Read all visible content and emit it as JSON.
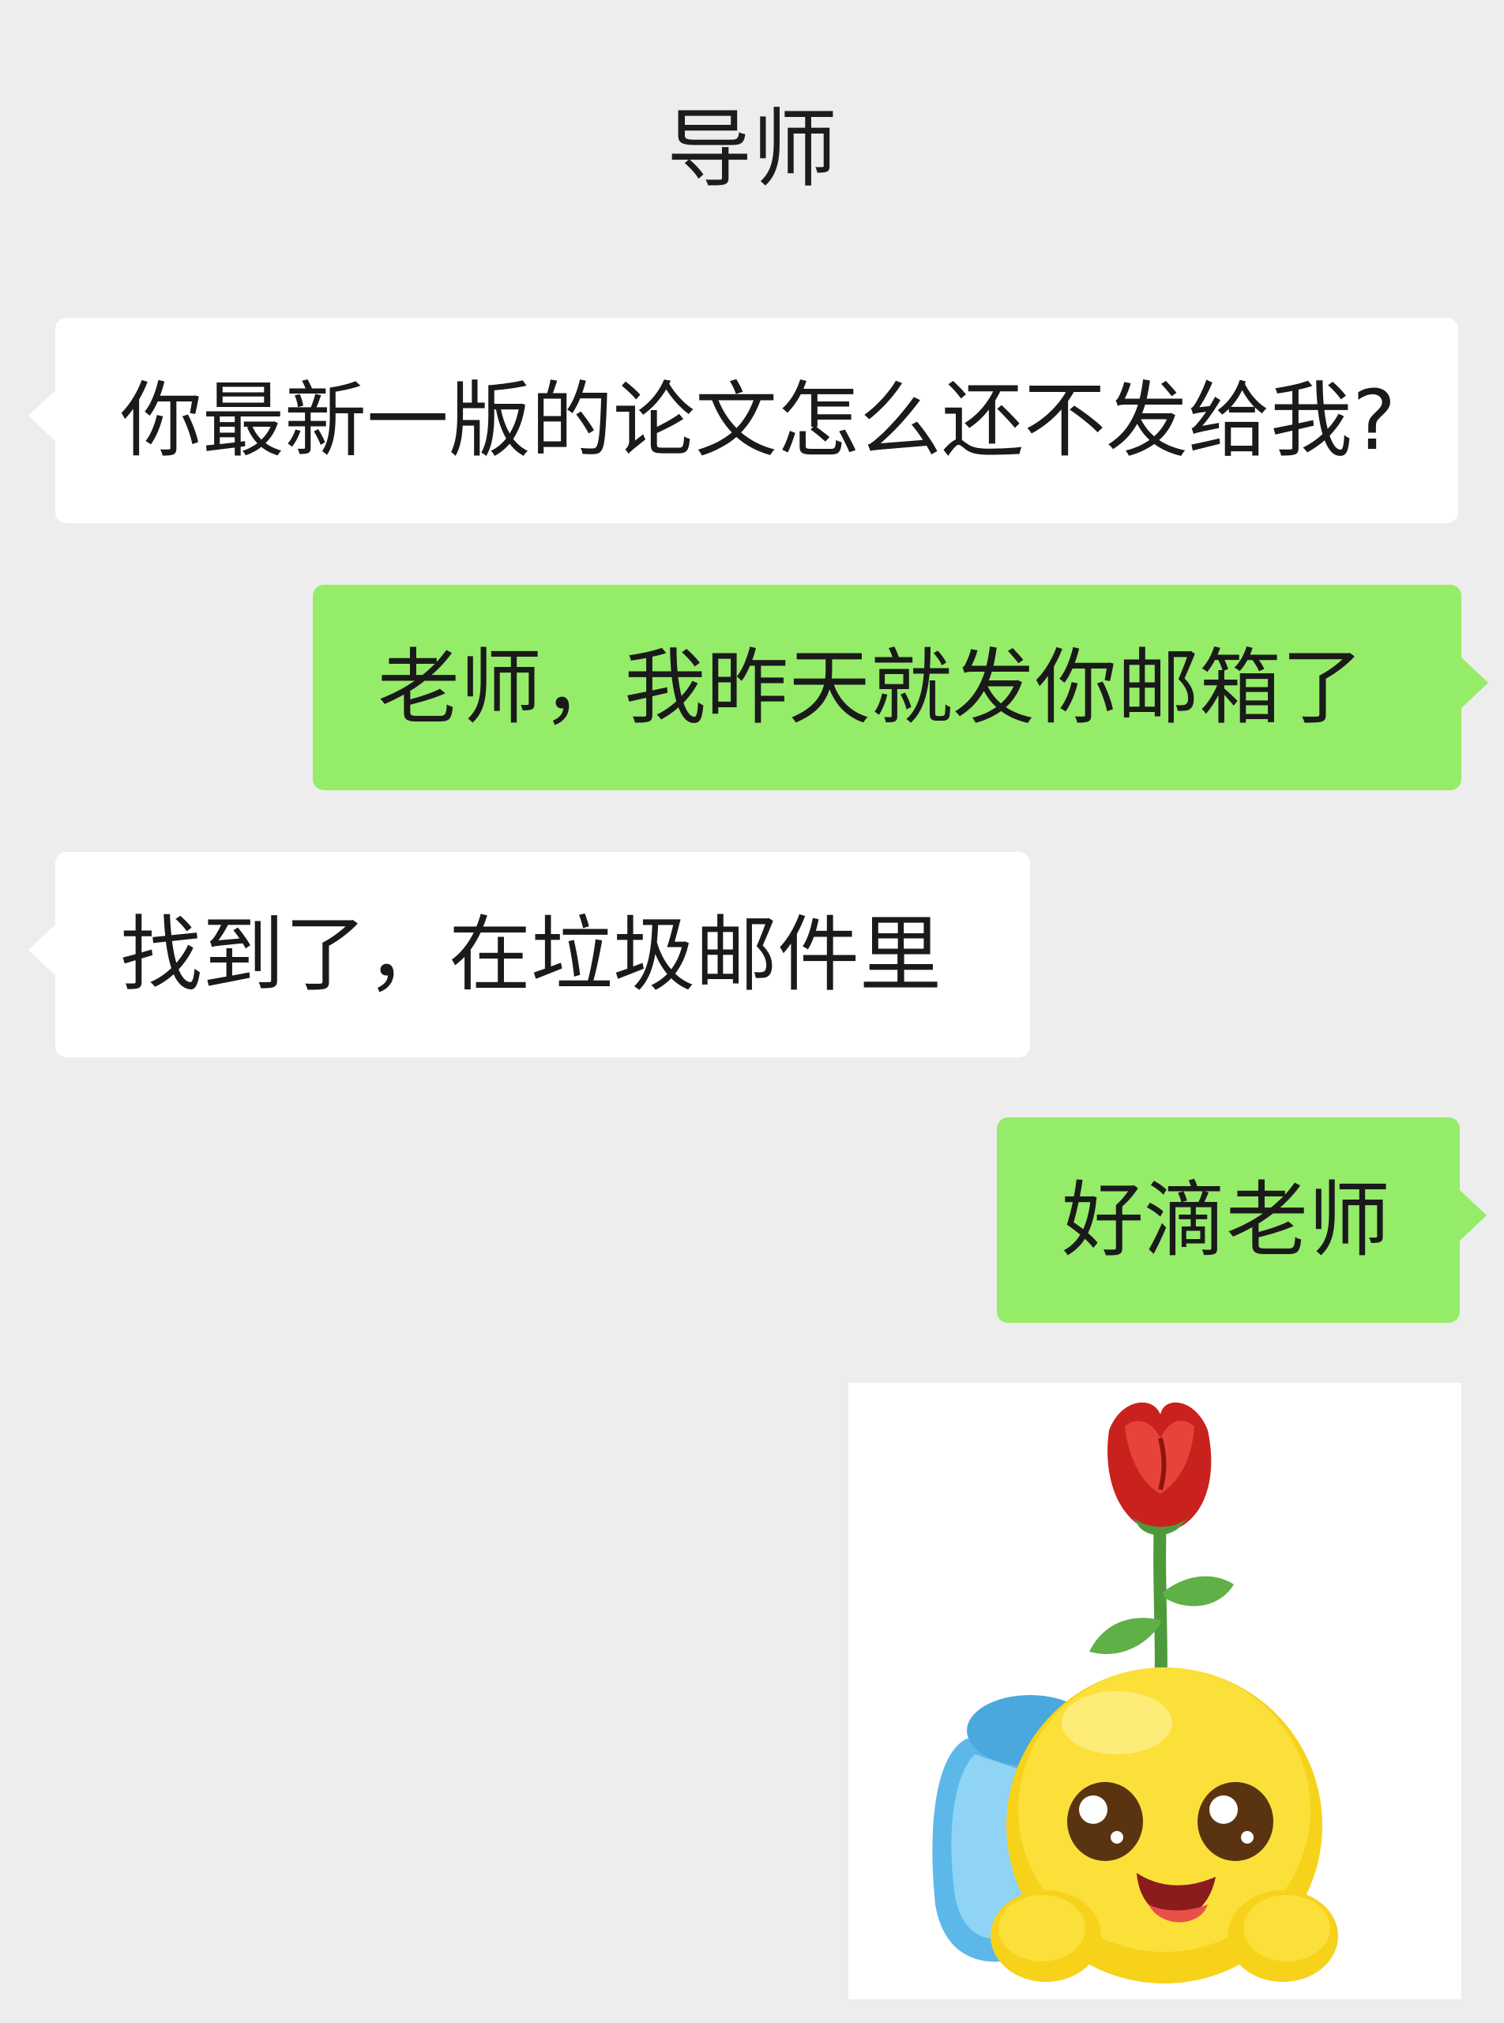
{
  "chat": {
    "title": "导师"
  },
  "messages": [
    {
      "sender": "other",
      "text": "你最新一版的论文怎么还不发给我?"
    },
    {
      "sender": "self",
      "text": "老师，我昨天就发你邮箱了"
    },
    {
      "sender": "other",
      "text": "找到了，在垃圾邮件里"
    },
    {
      "sender": "self",
      "text": "好滴老师"
    },
    {
      "sender": "self",
      "type": "sticker",
      "icon": "emoji-with-rose-sticker"
    }
  ],
  "colors": {
    "background": "#ededed",
    "incoming_bubble": "#ffffff",
    "outgoing_bubble": "#95ec69",
    "text": "#1a1a1a"
  }
}
